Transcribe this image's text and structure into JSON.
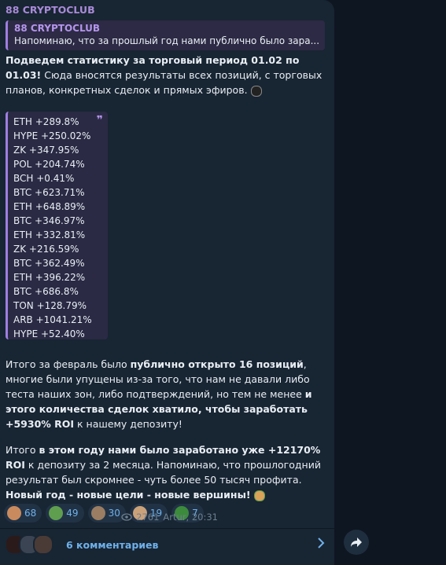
{
  "post": {
    "channel": "88 CRYPTOCLUB",
    "reply": {
      "author": "88 CRYPTOCLUB",
      "text": "Напоминаю, что за прошлый год нами публично было зара..."
    },
    "intro": {
      "bold": "Подведем статистику за торговый период 01.02 по 01.03!",
      "rest": " Сюда вносятся результаты всех позиций, с торговых планов, конкретных сделок и прямых эфиров."
    },
    "results": [
      "ETH +289.8%",
      "HYPE +250.02%",
      "ZK +347.95%",
      "POL +204.74%",
      "BCH +0.41%",
      "BTC +623.71%",
      "ETH +648.89%",
      "BTC +346.97%",
      "ETH +332.81%",
      "ZK +216.59%",
      "BTC +362.49%",
      "ETH +396.22%",
      "BTC +686.8%",
      "TON +128.79%",
      "ARB +1041.21%",
      "HYPE +52.40%"
    ],
    "para1": {
      "t1": "Итого за февраль было ",
      "b1": "публично открыто 16 позиций",
      "t2": ", многие были упущены из-за того, что нам не давали либо теста наших зон, либо подтверждений, но тем не менее ",
      "b2": "и этого количества сделок хватило, чтобы заработать +5930% ROI",
      "t3": " к нашему депозиту!"
    },
    "para2": {
      "t1": "Итого ",
      "b1": "в этом году нами было заработано уже +12170% ROI",
      "t2": " к депозиту за 2 месяца. Напоминаю, что прошлогодний результат был скромнее - чуть более 50 тысяч профита. ",
      "b2": "Новый год - новые цели - новые вершины!"
    },
    "reactions": [
      {
        "icon": "face-emoji-icon",
        "count": "68",
        "color": "#c98a5e"
      },
      {
        "icon": "money-emoji-icon",
        "count": "49",
        "color": "#5f9e4f"
      },
      {
        "icon": "cool-face-emoji-icon",
        "count": "30",
        "color": "#9a7d62"
      },
      {
        "icon": "praying-emoji-icon",
        "count": "19",
        "color": "#caa27a"
      },
      {
        "icon": "stonks-emoji-icon",
        "count": "7",
        "color": "#3c8b3c"
      }
    ],
    "views": "2761",
    "author_time": "Artur, 20:31",
    "comments_label": "6 комментариев"
  },
  "colors": {
    "accent": "#6fb1ea",
    "quote_bar": "#9f7ee0",
    "bubble": "#182533",
    "background": "#0e1621"
  }
}
